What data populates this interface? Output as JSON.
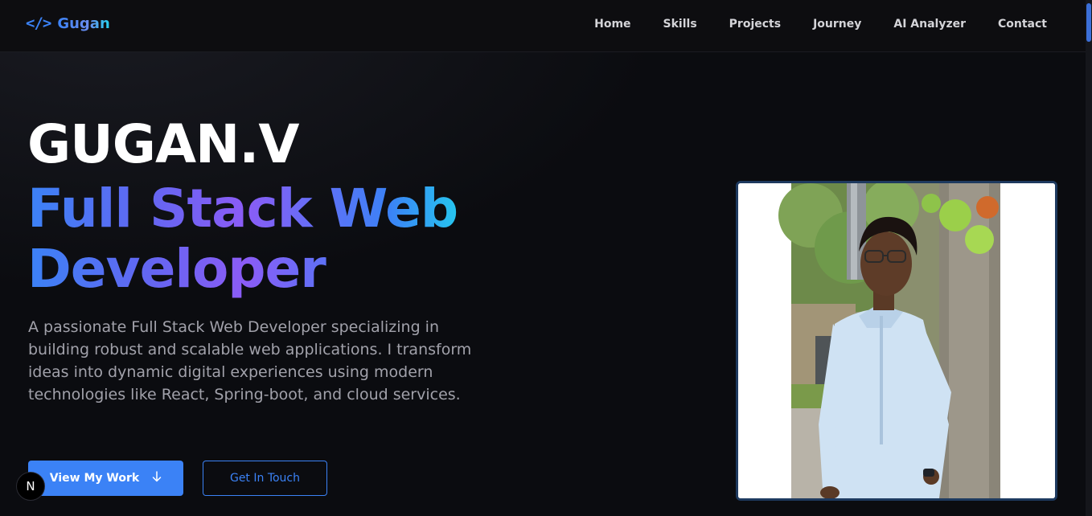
{
  "brand": {
    "icon": "code-icon",
    "icon_glyph": "</>",
    "name": "Gugan"
  },
  "nav": {
    "links": [
      "Home",
      "Skills",
      "Projects",
      "Journey",
      "AI Analyzer",
      "Contact"
    ]
  },
  "hero": {
    "name": "GUGAN.V",
    "role": "Full Stack Web Developer",
    "description": "A passionate Full Stack Web Developer specializing in building robust and scalable web applications. I transform ideas into dynamic digital experiences using modern technologies like React, Spring-boot, and cloud services.",
    "primary_button": "View My Work",
    "primary_button_icon": "arrow-down-icon",
    "secondary_button": "Get In Touch"
  },
  "badge": {
    "letter": "N"
  },
  "colors": {
    "accent": "#3b82f6",
    "gradient_mid": "#8b5cf6",
    "gradient_end": "#22d3ee",
    "background": "#0b0c10"
  }
}
